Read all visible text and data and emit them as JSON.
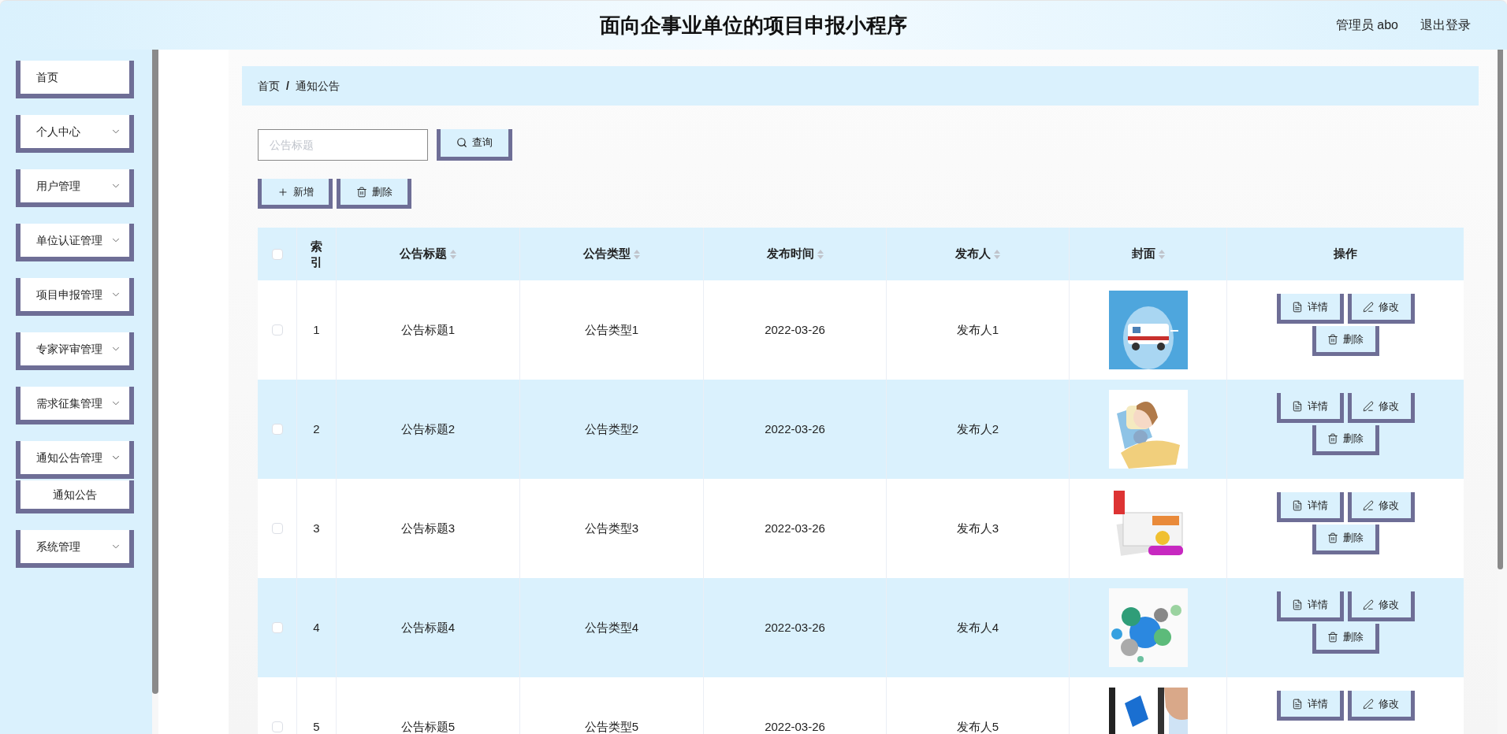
{
  "header": {
    "title": "面向企事业单位的项目申报小程序",
    "user": "管理员 abo",
    "logout": "退出登录"
  },
  "sidebar": {
    "items": [
      {
        "label": "首页",
        "kind": "link"
      },
      {
        "label": "个人中心",
        "kind": "submenu",
        "expanded": false
      },
      {
        "label": "用户管理",
        "kind": "submenu",
        "expanded": false
      },
      {
        "label": "单位认证管理",
        "kind": "submenu",
        "expanded": false
      },
      {
        "label": "项目申报管理",
        "kind": "submenu",
        "expanded": false
      },
      {
        "label": "专家评审管理",
        "kind": "submenu",
        "expanded": false
      },
      {
        "label": "需求征集管理",
        "kind": "submenu",
        "expanded": false
      },
      {
        "label": "通知公告管理",
        "kind": "submenu",
        "expanded": true,
        "children": [
          {
            "label": "通知公告"
          }
        ]
      },
      {
        "label": "系统管理",
        "kind": "submenu",
        "expanded": false
      }
    ]
  },
  "breadcrumb": [
    "首页",
    "/",
    "通知公告"
  ],
  "search": {
    "placeholder": "公告标题",
    "button": "查询"
  },
  "toolbar": [
    {
      "label": "新增",
      "kind": "add"
    },
    {
      "label": "删除",
      "kind": "delete"
    }
  ],
  "table": {
    "all_checked": false,
    "columns": [
      {
        "kind": "check"
      },
      {
        "label": "索引",
        "sortable": false
      },
      {
        "label": "公告标题",
        "sortable": true
      },
      {
        "label": "公告类型",
        "sortable": true
      },
      {
        "label": "发布时间",
        "sortable": true
      },
      {
        "label": "发布人",
        "sortable": true
      },
      {
        "label": "封面",
        "sortable": true
      },
      {
        "label": "操作",
        "sortable": false
      }
    ],
    "rows": [
      {
        "checked": false,
        "index": "1",
        "title": "公告标题1",
        "type": "公告类型1",
        "time": "2022-03-26",
        "publisher": "发布人1",
        "cover": {
          "kind": "picture"
        },
        "actions": [
          {
            "label": "详情",
            "kind": "detail"
          },
          {
            "label": "修改",
            "kind": "edit"
          },
          {
            "label": "删除",
            "kind": "delete"
          }
        ]
      },
      {
        "checked": false,
        "index": "2",
        "title": "公告标题2",
        "type": "公告类型2",
        "time": "2022-03-26",
        "publisher": "发布人2",
        "cover": {
          "kind": "picture"
        },
        "actions": [
          {
            "label": "详情",
            "kind": "detail"
          },
          {
            "label": "修改",
            "kind": "edit"
          },
          {
            "label": "删除",
            "kind": "delete"
          }
        ]
      },
      {
        "checked": false,
        "index": "3",
        "title": "公告标题3",
        "type": "公告类型3",
        "time": "2022-03-26",
        "publisher": "发布人3",
        "cover": {
          "kind": "picture"
        },
        "actions": [
          {
            "label": "详情",
            "kind": "detail"
          },
          {
            "label": "修改",
            "kind": "edit"
          },
          {
            "label": "删除",
            "kind": "delete"
          }
        ]
      },
      {
        "checked": false,
        "index": "4",
        "title": "公告标题4",
        "type": "公告类型4",
        "time": "2022-03-26",
        "publisher": "发布人4",
        "cover": {
          "kind": "picture"
        },
        "actions": [
          {
            "label": "详情",
            "kind": "detail"
          },
          {
            "label": "修改",
            "kind": "edit"
          },
          {
            "label": "删除",
            "kind": "delete"
          }
        ]
      },
      {
        "checked": false,
        "index": "5",
        "title": "公告标题5",
        "type": "公告类型5",
        "time": "2022-03-26",
        "publisher": "发布人5",
        "cover": {
          "kind": "picture"
        },
        "actions": [
          {
            "label": "详情",
            "kind": "detail"
          },
          {
            "label": "修改",
            "kind": "edit"
          }
        ]
      }
    ]
  }
}
